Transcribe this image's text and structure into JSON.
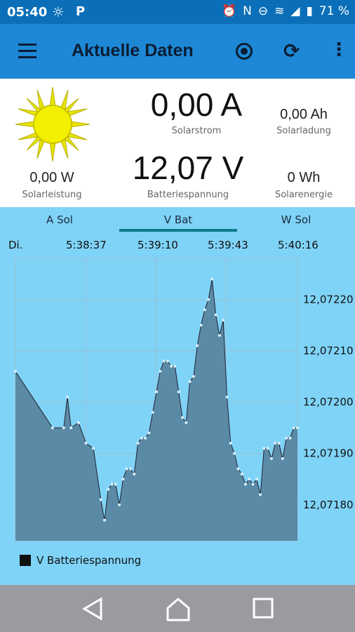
{
  "status_bar": {
    "time": "05:40",
    "battery": "71 %"
  },
  "app_bar": {
    "title": "Aktuelle Daten"
  },
  "readings": {
    "solar_current": {
      "value": "0,00 A",
      "label": "Solarstrom"
    },
    "solar_charge": {
      "value": "0,00 Ah",
      "label": "Solarladung"
    },
    "solar_power": {
      "value": "0,00 W",
      "label": "Solarleistung"
    },
    "battery_voltage": {
      "value": "12,07 V",
      "label": "Batteriespannung"
    },
    "solar_energy": {
      "value": "0 Wh",
      "label": "Solarenergie"
    }
  },
  "tabs": [
    {
      "label": "A Sol"
    },
    {
      "label": "V Bat"
    },
    {
      "label": "W Sol"
    }
  ],
  "active_tab": "V Bat",
  "time_axis": {
    "day": "Di.",
    "ticks": [
      "5:38:37",
      "5:39:10",
      "5:39:43",
      "5:40:16"
    ]
  },
  "chart_data": {
    "type": "area",
    "y_ticks": [
      "12,07220",
      "12,07210",
      "12,07200",
      "12,07190",
      "12,07180"
    ],
    "y_tick_values": [
      12.0722,
      12.0721,
      12.072,
      12.0719,
      12.0718
    ],
    "ylim": [
      12.07173,
      12.07228
    ],
    "series": [
      {
        "name": "V Batteriespannung",
        "points": [
          [
            0,
            12.07206
          ],
          [
            10,
            12.07195
          ],
          [
            13,
            12.07195
          ],
          [
            14,
            12.07201
          ],
          [
            15,
            12.07195
          ],
          [
            17,
            12.07196
          ],
          [
            19,
            12.07192
          ],
          [
            21,
            12.07191
          ],
          [
            23,
            12.07181
          ],
          [
            24,
            12.07177
          ],
          [
            25,
            12.07183
          ],
          [
            26,
            12.07184
          ],
          [
            27,
            12.07184
          ],
          [
            28,
            12.0718
          ],
          [
            29,
            12.07185
          ],
          [
            30,
            12.07187
          ],
          [
            31,
            12.07187
          ],
          [
            32,
            12.07186
          ],
          [
            33,
            12.07192
          ],
          [
            34,
            12.07193
          ],
          [
            35,
            12.07193
          ],
          [
            36,
            12.07194
          ],
          [
            37,
            12.07198
          ],
          [
            38,
            12.07202
          ],
          [
            39,
            12.07206
          ],
          [
            40,
            12.07208
          ],
          [
            41,
            12.07208
          ],
          [
            42,
            12.07207
          ],
          [
            43,
            12.07207
          ],
          [
            44,
            12.07202
          ],
          [
            45,
            12.07197
          ],
          [
            46,
            12.07196
          ],
          [
            47,
            12.07204
          ],
          [
            48,
            12.07205
          ],
          [
            49,
            12.07211
          ],
          [
            50,
            12.07215
          ],
          [
            51,
            12.07218
          ],
          [
            52,
            12.0722
          ],
          [
            53,
            12.07224
          ],
          [
            54,
            12.07217
          ],
          [
            55,
            12.07213
          ],
          [
            56,
            12.07216
          ],
          [
            57,
            12.07201
          ],
          [
            58,
            12.07192
          ],
          [
            59,
            12.0719
          ],
          [
            60,
            12.07187
          ],
          [
            61,
            12.07186
          ],
          [
            62,
            12.07184
          ],
          [
            63,
            12.07185
          ],
          [
            64,
            12.07184
          ],
          [
            65,
            12.07185
          ],
          [
            66,
            12.07182
          ],
          [
            67,
            12.07191
          ],
          [
            68,
            12.07191
          ],
          [
            69,
            12.07189
          ],
          [
            70,
            12.07192
          ],
          [
            71,
            12.07192
          ],
          [
            72,
            12.07189
          ],
          [
            73,
            12.07193
          ],
          [
            74,
            12.07193
          ],
          [
            75,
            12.07195
          ],
          [
            76,
            12.07195
          ]
        ]
      }
    ],
    "grid": true,
    "legend_position": "bottom-left"
  },
  "legend": {
    "label": "V Batteriespannung"
  },
  "colors": {
    "status_bar": "#0a6fb8",
    "app_bar": "#1e88d6",
    "chart_bg": "#7fd3f7",
    "area_fill": "#5a8aa6",
    "tab_indicator": "#0f7a8a",
    "nav_bar": "#9a9aa0"
  },
  "icons": {
    "menu": "hamburger-icon",
    "record": "record-icon",
    "refresh": "refresh-icon",
    "more": "more-vert-icon",
    "sun": "sun-icon"
  }
}
